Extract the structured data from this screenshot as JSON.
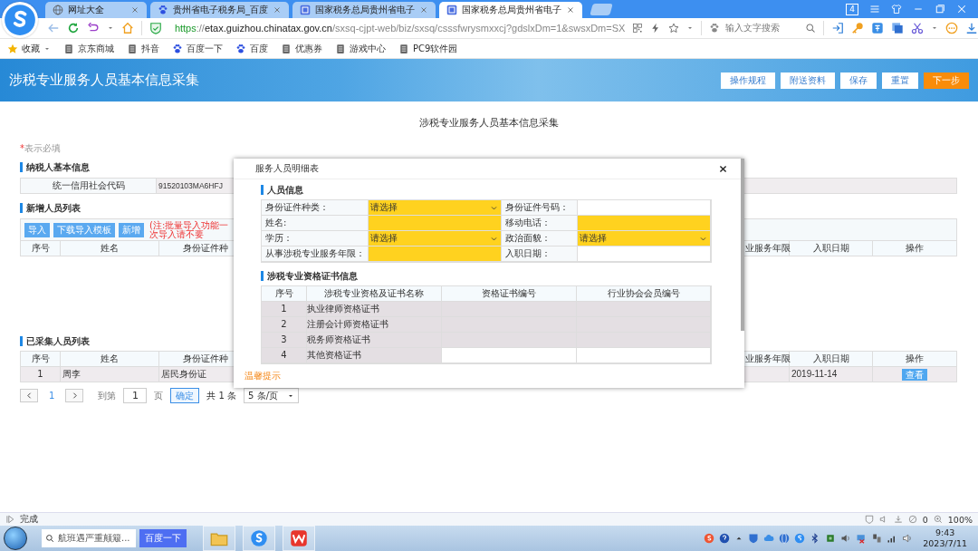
{
  "browser": {
    "tabs": [
      {
        "title": "网址大全",
        "kind": "home",
        "selected": false
      },
      {
        "title": "贵州省电子税务局_百度",
        "kind": "search",
        "selected": false
      },
      {
        "title": "国家税务总局贵州省电子",
        "kind": "site",
        "selected": false
      },
      {
        "title": "国家税务总局贵州省电子",
        "kind": "site",
        "selected": true
      }
    ],
    "window_count": "4",
    "url": {
      "scheme": "https",
      "separator": "://",
      "host": "etax.guizhou.chinatax.gov.cn",
      "path": "/sxsq-cjpt-web/biz/sxsq/csssfwrysmxxcj?gdslxDm=1&swsxDm=SX"
    },
    "search_placeholder": "输入文字搜索",
    "bookmarks": [
      {
        "label": "收藏",
        "kind": "favorites"
      },
      {
        "label": "京东商城",
        "kind": "page"
      },
      {
        "label": "抖音",
        "kind": "page"
      },
      {
        "label": "百度一下",
        "kind": "search"
      },
      {
        "label": "百度",
        "kind": "search"
      },
      {
        "label": "优惠券",
        "kind": "page"
      },
      {
        "label": "游戏中心",
        "kind": "page"
      },
      {
        "label": "PC9软件园",
        "kind": "page"
      }
    ]
  },
  "header": {
    "title": "涉税专业服务人员基本信息采集",
    "buttons": [
      {
        "label": "操作规程",
        "kind": "plain"
      },
      {
        "label": "附送资料",
        "kind": "plain"
      },
      {
        "label": "保存",
        "kind": "plain"
      },
      {
        "label": "重置",
        "kind": "plain"
      },
      {
        "label": "下一步",
        "kind": "primary"
      }
    ]
  },
  "page": {
    "title": "涉税专业服务人员基本信息采集",
    "required_mark": "*",
    "required_note": "表示必填",
    "taxpayer": {
      "heading": "纳税人基本信息",
      "label": "统一信用社会代码",
      "value": "91520103MA6HFJ"
    },
    "new_staff": {
      "heading": "新增人员列表",
      "buttons": [
        "导入",
        "下载导入模板",
        "新增"
      ],
      "note": "(注:批量导入功能一次导入请不要",
      "columns": [
        "序号",
        "姓名",
        "身份证件种",
        "业服务年限",
        "入职日期",
        "操作"
      ]
    },
    "collected": {
      "heading": "已采集人员列表",
      "columns": [
        "序号",
        "姓名",
        "身份证件种",
        "业服务年限",
        "入职日期",
        "操作"
      ],
      "rows": [
        {
          "index": "1",
          "name": "周李",
          "id_type": "居民身份证",
          "start_date": "2019-11-14",
          "action": "查看"
        }
      ]
    },
    "pagination": {
      "current": "1",
      "goto_label": "到第",
      "page_value": "1",
      "page_unit": "页",
      "confirm": "确定",
      "total": "共 1 条",
      "page_size": "5 条/页"
    }
  },
  "dialog": {
    "title": "服务人员明细表",
    "person_heading": "人员信息",
    "fields": [
      {
        "label": "身份证件种类：",
        "kind": "select",
        "value": "请选择",
        "required": true
      },
      {
        "label": "身份证件号码：",
        "kind": "input",
        "required": false
      },
      {
        "label": "姓名:",
        "kind": "input",
        "required": true
      },
      {
        "label": "移动电话：",
        "kind": "input",
        "required": true
      },
      {
        "label": "学历：",
        "kind": "select",
        "value": "请选择",
        "required": true
      },
      {
        "label": "政治面貌：",
        "kind": "select",
        "value": "请选择",
        "required": true
      },
      {
        "label": "从事涉税专业服务年限：",
        "kind": "input",
        "required": true
      },
      {
        "label": "入职日期：",
        "kind": "input",
        "required": false
      }
    ],
    "cert_heading": "涉税专业资格证书信息",
    "cert_columns": [
      "序号",
      "涉税专业资格及证书名称",
      "资格证书编号",
      "行业协会会员编号"
    ],
    "cert_rows": [
      {
        "index": "1",
        "name": "执业律师资格证书",
        "disabled": true
      },
      {
        "index": "2",
        "name": "注册会计师资格证书",
        "disabled": true
      },
      {
        "index": "3",
        "name": "税务师资格证书",
        "disabled": true
      },
      {
        "index": "4",
        "name": "其他资格证书",
        "disabled": false
      }
    ],
    "tip": "温馨提示"
  },
  "status_bar": {
    "text": "完成",
    "count": "0",
    "zoom": "100%"
  },
  "taskbar": {
    "search_placeholder": "航班遇严重颠簸...",
    "search_button": "百度一下",
    "time": "9:43",
    "date": "2023/7/11"
  }
}
